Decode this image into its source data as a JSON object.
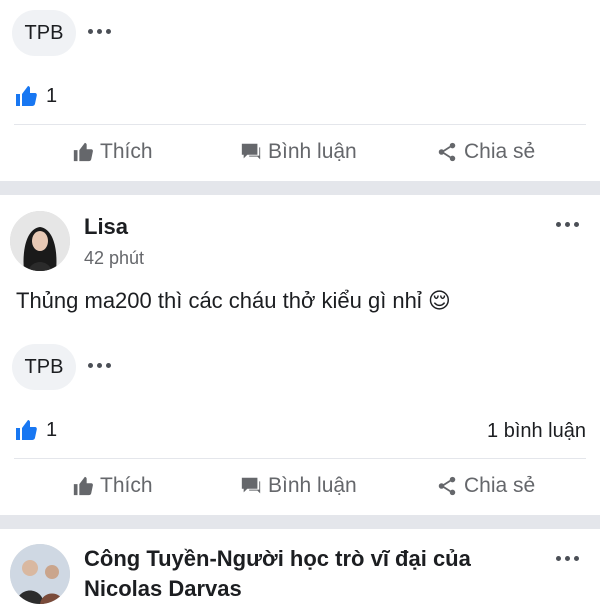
{
  "post1": {
    "tag": "TPB",
    "like_count": "1",
    "actions": {
      "like": "Thích",
      "comment": "Bình luận",
      "share": "Chia sẻ"
    }
  },
  "post2": {
    "author": "Lisa",
    "time": "42 phút",
    "text": "Thủng ma200 thì các cháu thở kiểu gì nhỉ 😌",
    "tag": "TPB",
    "like_count": "1",
    "comments_count": "1 bình luận",
    "actions": {
      "like": "Thích",
      "comment": "Bình luận",
      "share": "Chia sẻ"
    }
  },
  "post3": {
    "author_line1": "Công Tuyền-Người học trò vĩ đại của",
    "author_line2": "Nicolas Darvas"
  },
  "colors": {
    "like_blue": "#1877f2",
    "muted_gray": "#65676b",
    "separator": "#e4e6eb"
  },
  "icons": [
    "more-icon",
    "like-reaction-icon",
    "thumbs-up-icon",
    "comment-icon",
    "share-icon"
  ]
}
